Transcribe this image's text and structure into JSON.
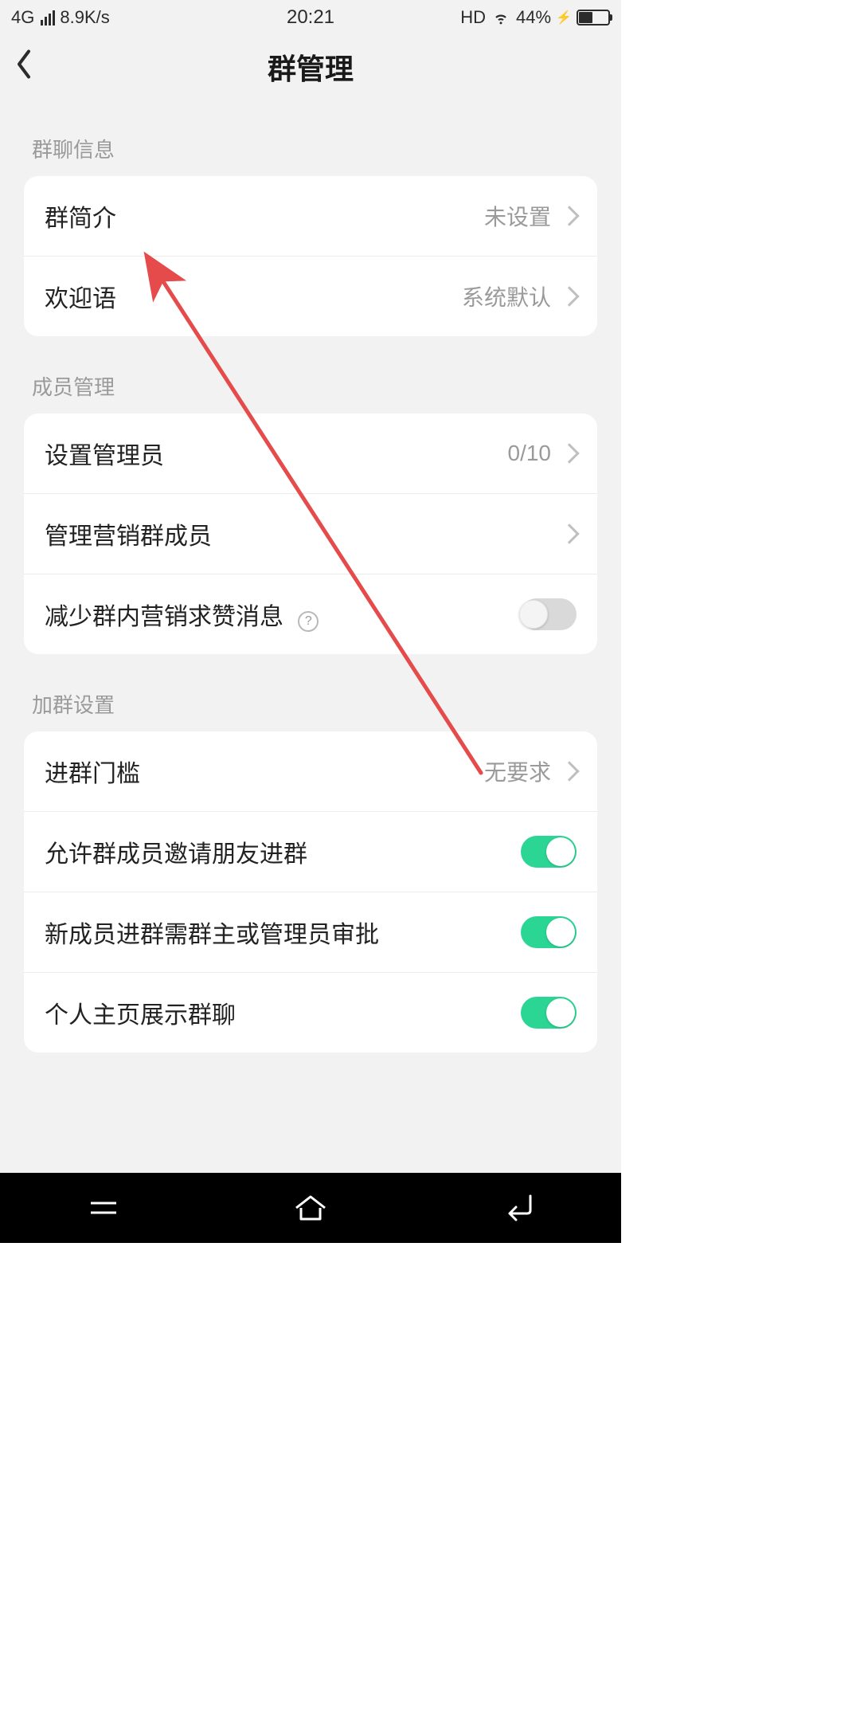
{
  "status": {
    "network_type": "4G",
    "speed": "8.9K/s",
    "time": "20:21",
    "hd": "HD",
    "battery_pct": "44%",
    "charging": "⚡"
  },
  "header": {
    "title": "群管理"
  },
  "sections": {
    "chat_info": {
      "header": "群聊信息",
      "rows": {
        "intro": {
          "label": "群简介",
          "value": "未设置"
        },
        "welcome": {
          "label": "欢迎语",
          "value": "系统默认"
        }
      }
    },
    "member_mgmt": {
      "header": "成员管理",
      "rows": {
        "set_admin": {
          "label": "设置管理员",
          "value": "0/10"
        },
        "manage_marketing": {
          "label": "管理营销群成员"
        },
        "reduce_spam": {
          "label": "减少群内营销求赞消息",
          "help_char": "?",
          "switch": false
        }
      }
    },
    "join_settings": {
      "header": "加群设置",
      "rows": {
        "threshold": {
          "label": "进群门槛",
          "value": "无要求"
        },
        "allow_invite": {
          "label": "允许群成员邀请朋友进群",
          "switch": true
        },
        "need_approval": {
          "label": "新成员进群需群主或管理员审批",
          "switch": true
        },
        "show_on_profile": {
          "label": "个人主页展示群聊",
          "switch": true
        }
      }
    }
  },
  "annotation": {
    "color": "#e64b4b"
  }
}
